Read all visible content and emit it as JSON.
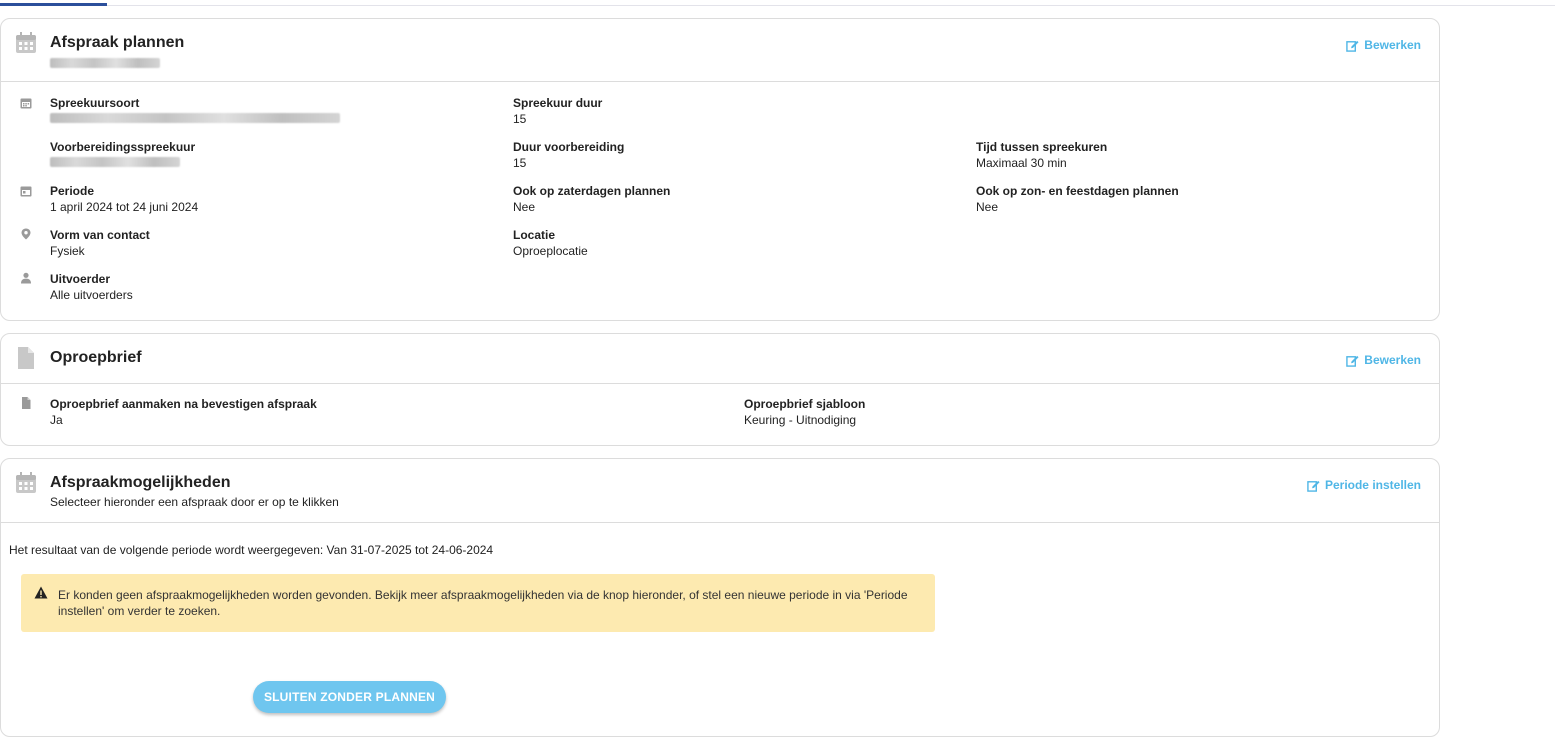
{
  "card1": {
    "title": "Afspraak plannen",
    "edit_label": "Bewerken",
    "fields": {
      "spreekuursoort_label": "Spreekuursoort",
      "spreekuur_duur_label": "Spreekuur duur",
      "spreekuur_duur_value": "15",
      "voorbereidingsspreekuur_label": "Voorbereidingsspreekuur",
      "duur_voorbereiding_label": "Duur voorbereiding",
      "duur_voorbereiding_value": "15",
      "tijd_tussen_label": "Tijd tussen spreekuren",
      "tijd_tussen_value": "Maximaal 30 min",
      "periode_label": "Periode",
      "periode_value": "1 april 2024 tot 24 juni 2024",
      "zaterdag_label": "Ook op zaterdagen plannen",
      "zaterdag_value": "Nee",
      "zondag_label": "Ook op zon- en feestdagen plannen",
      "zondag_value": "Nee",
      "vorm_label": "Vorm van contact",
      "vorm_value": "Fysiek",
      "locatie_label": "Locatie",
      "locatie_value": "Oproeplocatie",
      "uitvoerder_label": "Uitvoerder",
      "uitvoerder_value": "Alle uitvoerders"
    }
  },
  "card2": {
    "title": "Oproepbrief",
    "edit_label": "Bewerken",
    "fields": {
      "aanmaken_label": "Oproepbrief aanmaken na bevestigen afspraak",
      "aanmaken_value": "Ja",
      "sjabloon_label": "Oproepbrief sjabloon",
      "sjabloon_value": "Keuring - Uitnodiging"
    }
  },
  "card3": {
    "title": "Afspraakmogelijkheden",
    "subtitle": "Selecteer hieronder een afspraak door er op te klikken",
    "edit_label": "Periode instellen",
    "period_text": "Het resultaat van de volgende periode wordt weergegeven: Van 31-07-2025 tot 24-06-2024",
    "alert_text": "Er konden geen afspraakmogelijkheden worden gevonden. Bekijk meer afspraakmogelijkheden via de knop hieronder, of stel een nieuwe periode in via 'Periode instellen' om verder te zoeken.",
    "close_button": "SLUITEN ZONDER PLANNEN"
  },
  "icons": {
    "calendar": "calendar-icon",
    "document": "document-icon",
    "location": "map-marker-icon",
    "person": "user-icon",
    "edit": "edit-icon",
    "warning": "warning-icon"
  },
  "colors": {
    "accent": "#4fb6e6",
    "button": "#6fc6ef",
    "alert_bg": "#fdeab0",
    "tab_active": "#2b4f9b"
  }
}
